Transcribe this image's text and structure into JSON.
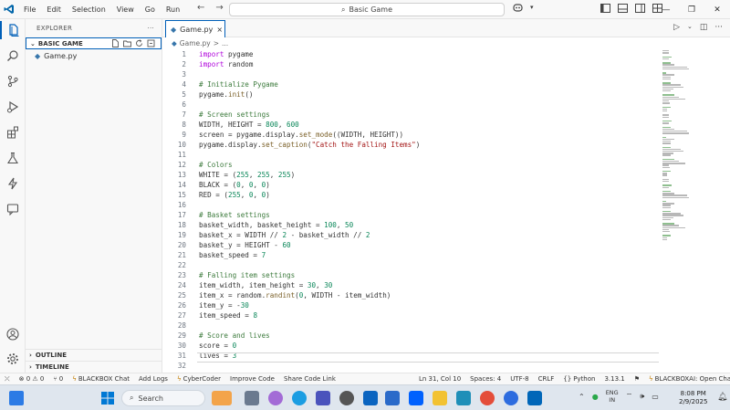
{
  "menu": [
    "File",
    "Edit",
    "Selection",
    "View",
    "Go",
    "Run"
  ],
  "search": {
    "label": "Basic Game"
  },
  "explorer": {
    "title": "EXPLORER",
    "more": "···",
    "folder": "BASIC GAME",
    "files": [
      "Game.py"
    ],
    "outline": "OUTLINE",
    "timeline": "TIMELINE"
  },
  "tab": {
    "label": "Game.py",
    "close": "×"
  },
  "breadcrumb": {
    "file": "Game.py",
    "sep": ">",
    "rest": "..."
  },
  "code_lines": [
    "import pygame",
    "import random",
    "",
    "# Initialize Pygame",
    "pygame.init()",
    "",
    "# Screen settings",
    "WIDTH, HEIGHT = 800, 600",
    "screen = pygame.display.set_mode((WIDTH, HEIGHT))",
    "pygame.display.set_caption(\"Catch the Falling Items\")",
    "",
    "# Colors",
    "WHITE = (255, 255, 255)",
    "BLACK = (0, 0, 0)",
    "RED = (255, 0, 0)",
    "",
    "# Basket settings",
    "basket_width, basket_height = 100, 50",
    "basket_x = WIDTH // 2 - basket_width // 2",
    "basket_y = HEIGHT - 60",
    "basket_speed = 7",
    "",
    "# Falling item settings",
    "item_width, item_height = 30, 30",
    "item_x = random.randint(0, WIDTH - item_width)",
    "item_y = -30",
    "item_speed = 8",
    "",
    "# Score and lives",
    "score = 0",
    "lives = 3",
    ""
  ],
  "status": {
    "errors": "⊗ 0 ⚠ 0",
    "ports": "⑂ 0",
    "blackbox_chat": "BLACKBOX Chat",
    "add_logs": "Add Logs",
    "cybercoder": "CyberCoder",
    "improve_code": "Improve Code",
    "share_code_link": "Share Code Link",
    "position": "Ln 31, Col 10",
    "spaces": "Spaces: 4",
    "encoding": "UTF-8",
    "eol": "CRLF",
    "language": "Python",
    "version": "3.13.1",
    "blackboxai": "BLACKBOXAI: Open Chat"
  },
  "taskbar": {
    "search": "Search",
    "lang_1": "ENG",
    "lang_2": "IN",
    "time": "8:08 PM",
    "date": "2/9/2025"
  },
  "colors": {
    "accent": "#005fb8",
    "keyword": "#af00db",
    "comment": "#3c7a3c"
  }
}
